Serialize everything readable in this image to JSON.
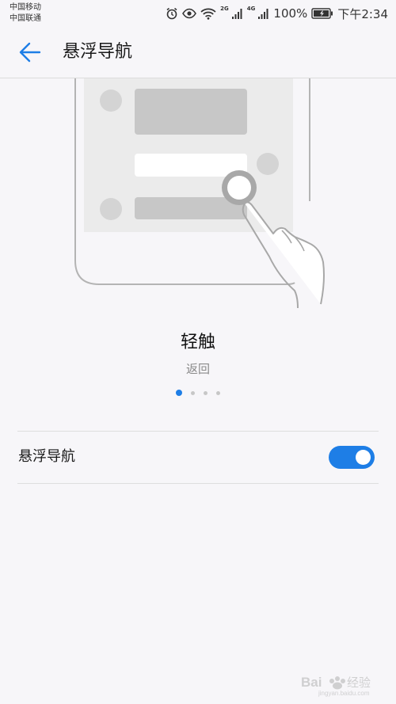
{
  "status_bar": {
    "carrier_1": "中国移动",
    "carrier_2": "中国联通",
    "network_tag_1": "2G",
    "network_tag_2": "4G",
    "battery": "100%",
    "time": "下午2:34",
    "icons": [
      "alarm-icon",
      "eye-icon",
      "wifi-icon",
      "signal-icon",
      "signal-icon",
      "battery-icon"
    ]
  },
  "header": {
    "title": "悬浮导航",
    "back_icon": "arrow-left-icon",
    "accent_color": "#1e7ee6"
  },
  "gesture": {
    "title": "轻触",
    "subtitle": "返回",
    "page_count": 4,
    "active_page": 1
  },
  "settings": {
    "floating_nav_label": "悬浮导航",
    "floating_nav_enabled": true
  },
  "watermark": {
    "text": "Bai 经验",
    "subtext": "jingyan.baidu.com"
  }
}
